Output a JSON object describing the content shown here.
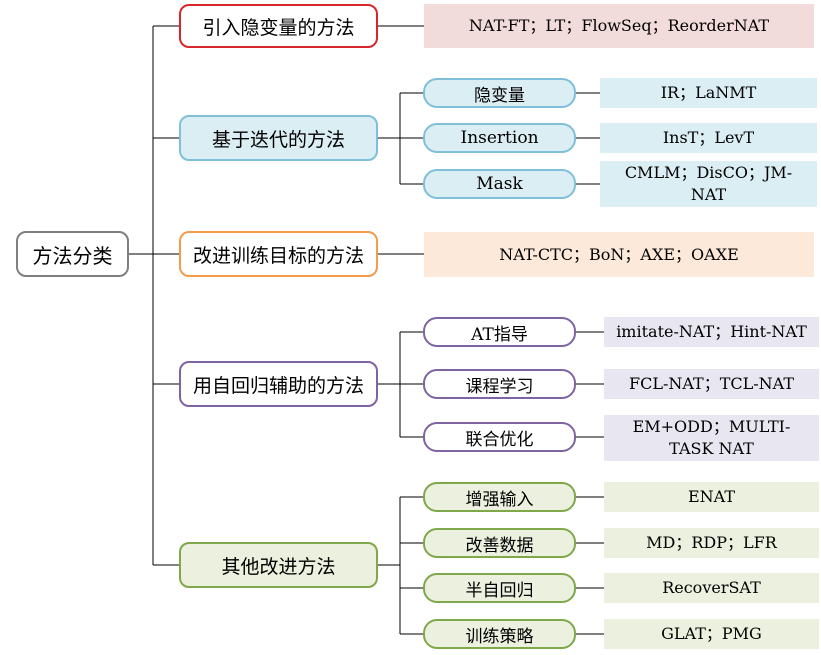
{
  "diagram": {
    "root": {
      "label": "方法分类"
    },
    "categories": [
      {
        "label": "引入隐变量的方法",
        "leaf": "NAT-FT；LT；FlowSeq；ReorderNAT"
      },
      {
        "label": "基于迭代的方法",
        "children": [
          {
            "label": "隐变量",
            "leaf": "IR；LaNMT"
          },
          {
            "label": "Insertion",
            "leaf": "InsT；LevT"
          },
          {
            "label": "Mask",
            "leaf": "CMLM；DisCO；JM-NAT"
          }
        ]
      },
      {
        "label": "改进训练目标的方法",
        "leaf": "NAT-CTC；BoN；AXE；OAXE"
      },
      {
        "label": "用自回归辅助的方法",
        "children": [
          {
            "label": "AT指导",
            "leaf": "imitate-NAT；Hint-NAT"
          },
          {
            "label": "课程学习",
            "leaf": "FCL-NAT；TCL-NAT"
          },
          {
            "label": "联合优化",
            "leaf": "EM+ODD；MULTI-TASK NAT"
          }
        ]
      },
      {
        "label": "其他改进方法",
        "children": [
          {
            "label": "增强输入",
            "leaf": "ENAT"
          },
          {
            "label": "改善数据",
            "leaf": "MD；RDP；LFR"
          },
          {
            "label": "半自回归",
            "leaf": "RecoverSAT"
          },
          {
            "label": "训练策略",
            "leaf": "GLAT；PMG"
          }
        ]
      }
    ],
    "colors": {
      "root_border": "#7f7f7f",
      "root_fill": "#ffffff",
      "line": "#000000",
      "red_border": "#d9262c",
      "red_leaf": "#f2dcdb",
      "blue_border": "#7fc0d8",
      "blue_fill": "#dbeef4",
      "blue_leaf": "#dbeef4",
      "orange_border": "#f39c4c",
      "orange_leaf": "#fde9d9",
      "purple_border": "#8064a2",
      "purple_leaf": "#e8e6f0",
      "green_border": "#7fa84b",
      "green_fill": "#ebf1de",
      "green_leaf": "#ebf1de"
    }
  }
}
